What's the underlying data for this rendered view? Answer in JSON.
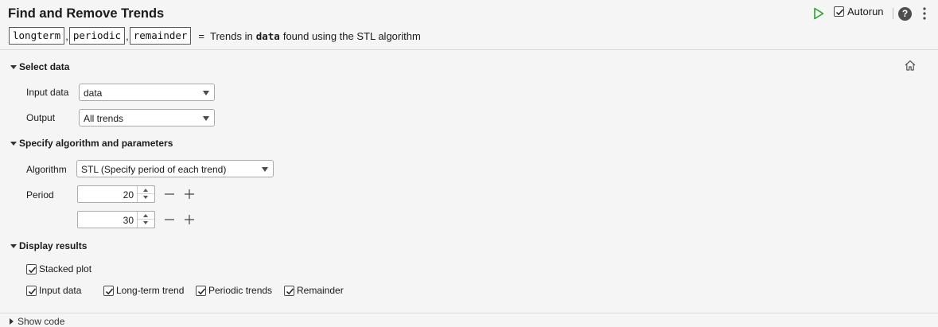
{
  "header": {
    "title": "Find and Remove Trends",
    "outputs": [
      "longterm",
      "periodic",
      "remainder"
    ],
    "equals": "=",
    "description_prefix": "Trends in",
    "description_var": "data",
    "description_suffix": "found using the STL algorithm",
    "autorun_label": "Autorun",
    "autorun_checked": true,
    "help_glyph": "?"
  },
  "select_data": {
    "heading": "Select data",
    "input_label": "Input data",
    "input_value": "data",
    "output_label": "Output",
    "output_value": "All trends"
  },
  "algorithm": {
    "heading": "Specify algorithm and parameters",
    "algorithm_label": "Algorithm",
    "algorithm_value": "STL (Specify period of each trend)",
    "period_label": "Period",
    "periods": [
      "20",
      "30"
    ]
  },
  "display": {
    "heading": "Display results",
    "stacked_plot": "Stacked plot",
    "input_data": "Input data",
    "long_term_trend": "Long-term trend",
    "periodic_trends": "Periodic trends",
    "remainder": "Remainder"
  },
  "footer": {
    "show_code": "Show code"
  },
  "icons": {
    "run": "play-icon",
    "help": "help-icon",
    "more": "more-vertical-icon",
    "home": "home-icon",
    "check": "checkmark-icon"
  },
  "colors": {
    "run_green": "#29a329",
    "background": "#f5f5f5"
  }
}
